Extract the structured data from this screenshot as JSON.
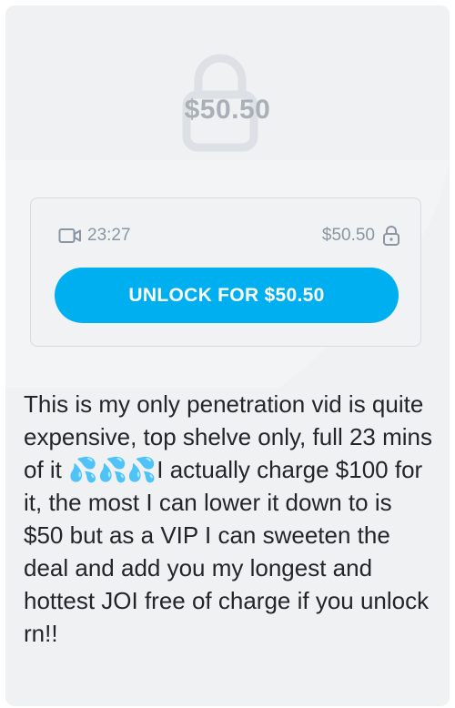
{
  "preview": {
    "price_overlay": "$50.50"
  },
  "purchase": {
    "duration": "23:27",
    "price": "$50.50",
    "unlock_label": "UNLOCK FOR $50.50"
  },
  "caption": {
    "text": "This is my only penetration vid is quite expensive, top shelve only, full 23 mins of it 💦💦💦I actually charge $100 for it, the most I can lower it down to is $50 but as a VIP I can sweeten the deal and add you my longest and hottest JOI free of charge if you unlock rn!!"
  },
  "colors": {
    "accent": "#00aff0",
    "card_bg": "#eff1f3",
    "muted": "#8a96a3",
    "text": "#242529"
  },
  "icons": {
    "lock": "lock-icon",
    "video": "video-camera-icon",
    "small_lock": "small-lock-icon"
  }
}
